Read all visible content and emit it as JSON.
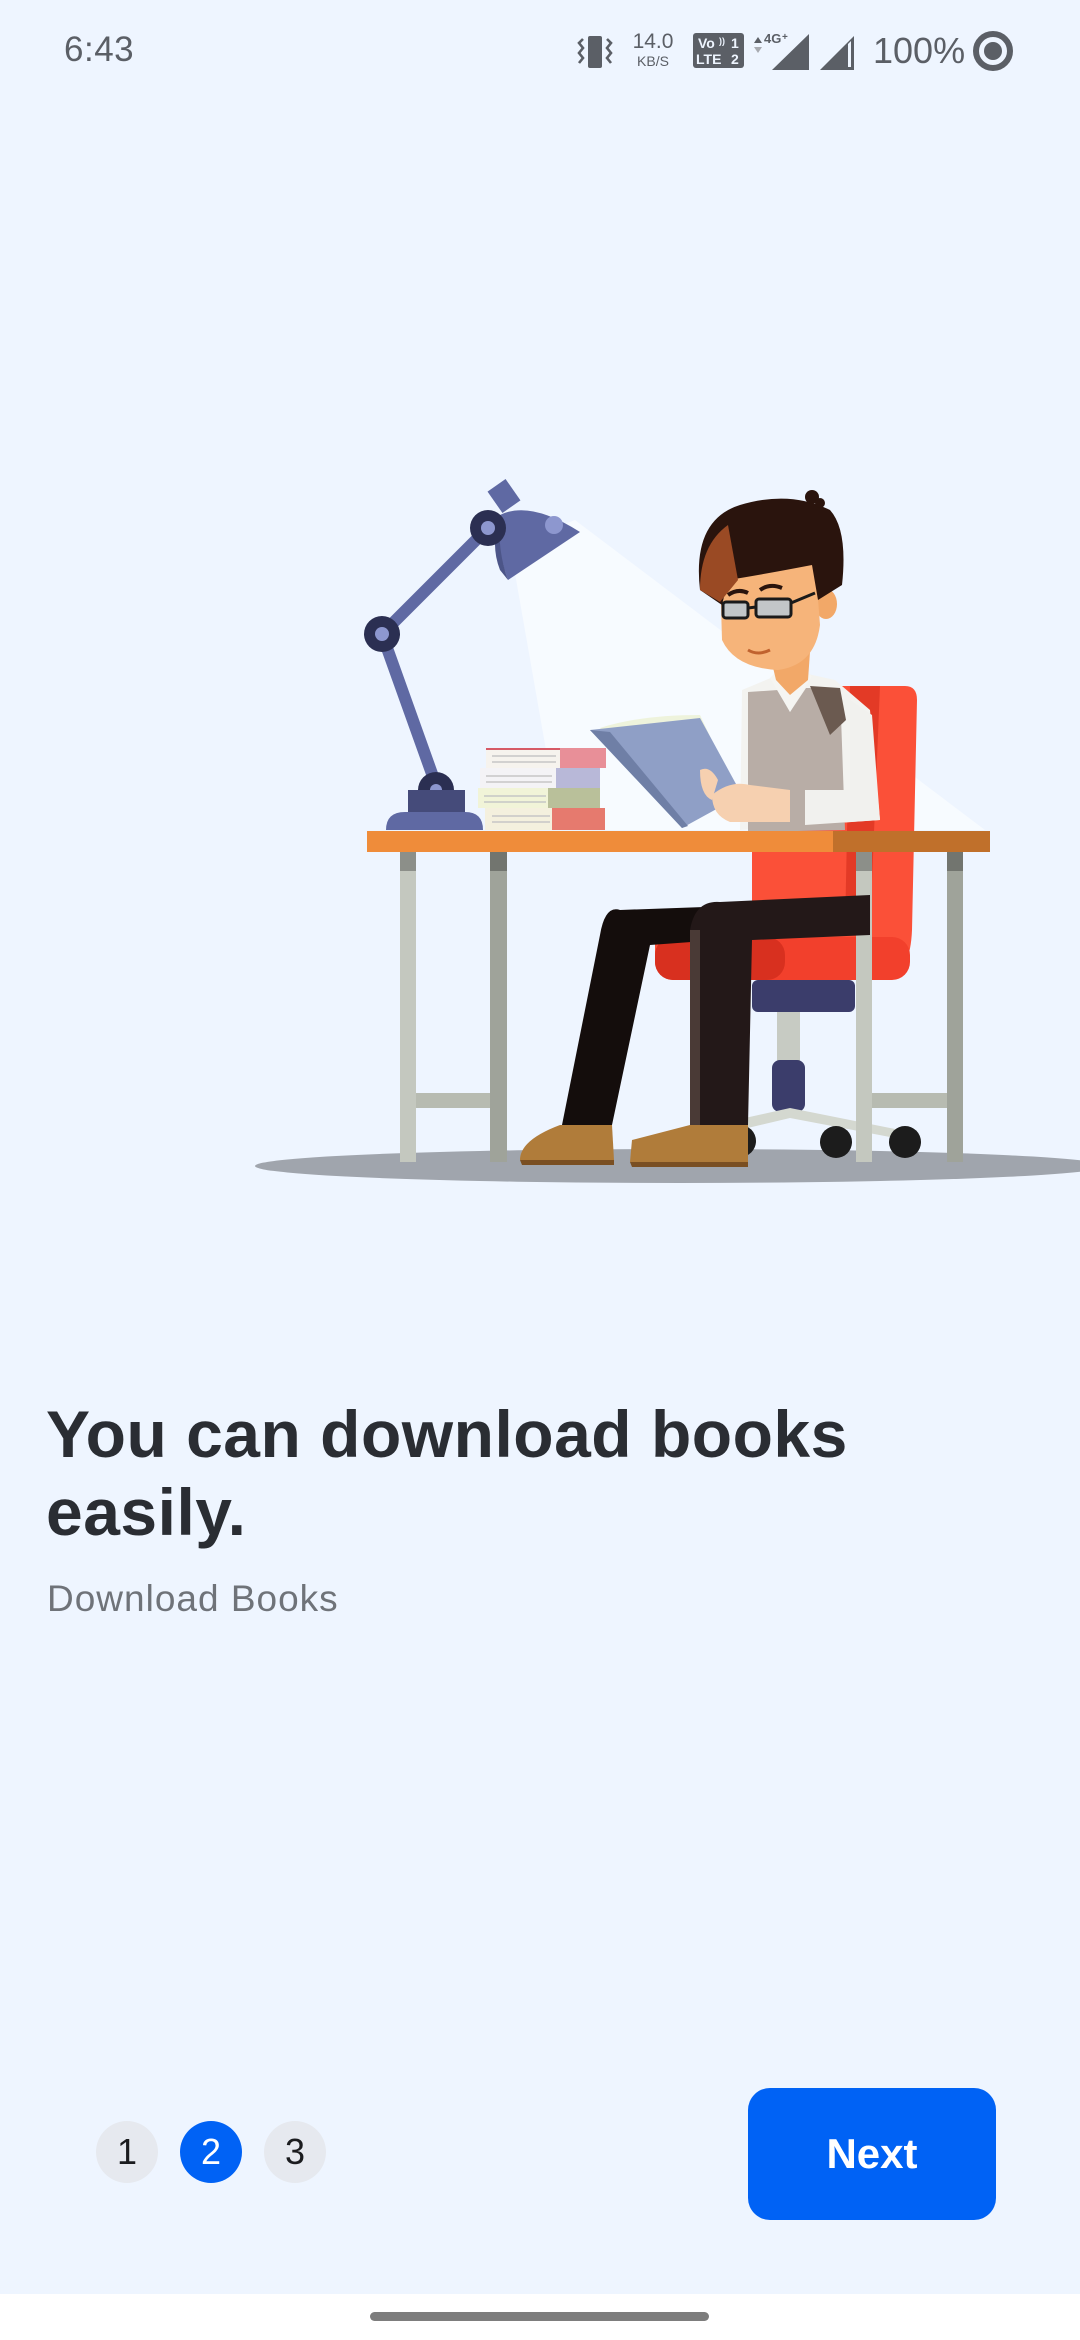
{
  "status_bar": {
    "time": "6:43",
    "net_speed_value": "14.0",
    "net_speed_unit": "KB/S",
    "volte_line1": "Vo",
    "volte_sim1": "1",
    "volte_line2": "LTE",
    "volte_sim2": "2",
    "network_type": "4G+",
    "battery_percent": "100%",
    "icons": [
      "vibrate-icon",
      "volte-icon",
      "signal-4g-icon",
      "signal-icon",
      "battery-saver-icon"
    ]
  },
  "onboarding": {
    "illustration": "person-reading-at-desk",
    "title": "You can download books easily.",
    "subtitle": "Download Books",
    "pages": [
      {
        "label": "1",
        "active": false
      },
      {
        "label": "2",
        "active": true
      },
      {
        "label": "3",
        "active": false
      }
    ],
    "current_page": 2,
    "total_pages": 3,
    "next_label": "Next"
  },
  "colors": {
    "accent": "#0062f5",
    "background": "#eef5ff",
    "title_text": "#2a2d33",
    "subtitle_text": "#6f7379",
    "dot_inactive": "#e6e9ef"
  }
}
